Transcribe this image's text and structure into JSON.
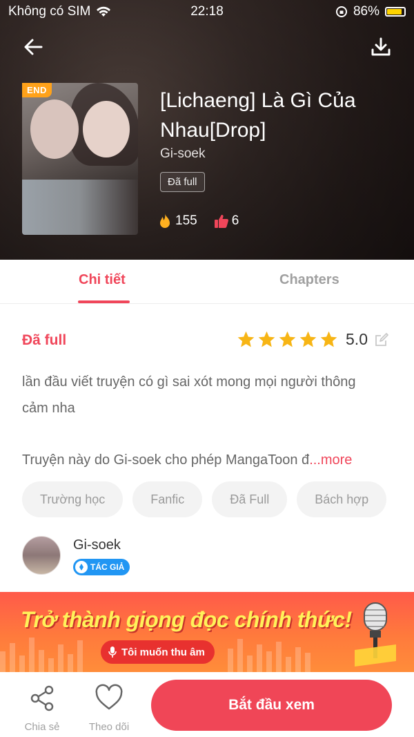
{
  "status_bar": {
    "carrier": "Không có SIM",
    "time": "22:18",
    "battery_pct": "86%",
    "battery_fill": 0.86
  },
  "header": {
    "end_badge": "END",
    "title": "[Lichaeng] Là Gì Của Nhau[Drop]",
    "author": "Gi-soek",
    "status": "Đã full",
    "fire_count": "155",
    "like_count": "6"
  },
  "tabs": {
    "detail": "Chi tiết",
    "chapters": "Chapters"
  },
  "detail": {
    "status_label": "Đã full",
    "rating_value": "5.0",
    "rating_stars": 5,
    "description": "lần đầu viết truyện có gì sai xót mong mọi người thông cảm nha",
    "license_text": "Truyện này do Gi-soek cho phép MangaToon đ",
    "more_label": "...more",
    "tags": [
      "Trường học",
      "Fanfic",
      "Đã Full",
      "Bách hợp"
    ]
  },
  "author": {
    "name": "Gi-soek",
    "badge": "TÁC GIẢ"
  },
  "banner": {
    "title": "Trở thành giọng đọc chính thức!",
    "button": "Tôi muốn thu âm"
  },
  "bottom_bar": {
    "share_label": "Chia sẻ",
    "follow_label": "Theo dõi",
    "start_label": "Bắt đầu xem"
  },
  "colors": {
    "accent": "#f0465a",
    "end_badge": "#ffa21a",
    "author_badge": "#2196f3",
    "star": "#f7b515"
  },
  "icons": {
    "back": "arrow-left-icon",
    "download": "download-icon",
    "fire": "fire-icon",
    "like": "thumbs-up-icon",
    "edit": "edit-icon",
    "share": "share-icon",
    "follow": "heart-icon",
    "mic": "microphone-icon"
  }
}
